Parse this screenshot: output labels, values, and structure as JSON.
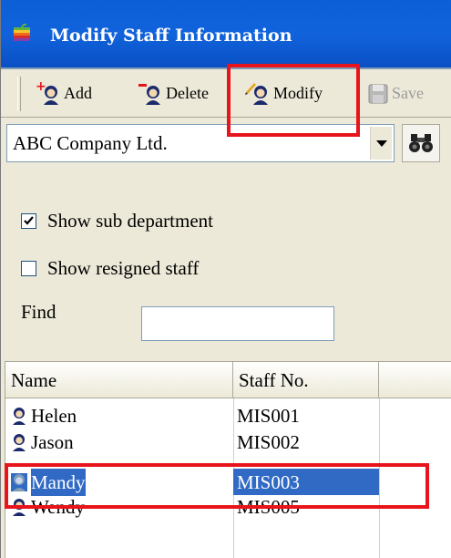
{
  "window": {
    "title": "Modify Staff Information"
  },
  "toolbar": {
    "add_label": "Add",
    "delete_label": "Delete",
    "modify_label": "Modify",
    "save_label": "Save",
    "save_enabled": false
  },
  "company": {
    "selected": "ABC Company Ltd."
  },
  "options": {
    "show_sub_department_label": "Show sub department",
    "show_sub_department_checked": true,
    "show_resigned_label": "Show resigned staff",
    "show_resigned_checked": false,
    "find_label": "Find",
    "find_value": ""
  },
  "grid": {
    "columns": [
      "Name",
      "Staff No.",
      ""
    ],
    "rows": [
      {
        "name": "Helen",
        "staff_no": "MIS001",
        "selected": false
      },
      {
        "name": "Jason",
        "staff_no": "MIS002",
        "selected": false
      },
      {
        "name": "Mandy",
        "staff_no": "MIS003",
        "selected": true
      },
      {
        "name": "Wendy",
        "staff_no": "MIS005",
        "selected": false
      }
    ]
  },
  "colors": {
    "titlebar": "#0d5fd8",
    "selection": "#316ac5",
    "highlight": "#e8141b"
  },
  "icons": {
    "title": "app-apple-icon",
    "add": "add-person-icon",
    "delete": "delete-person-icon",
    "modify": "modify-person-icon",
    "save": "save-disk-icon",
    "find": "binoculars-icon",
    "row": "person-icon"
  }
}
